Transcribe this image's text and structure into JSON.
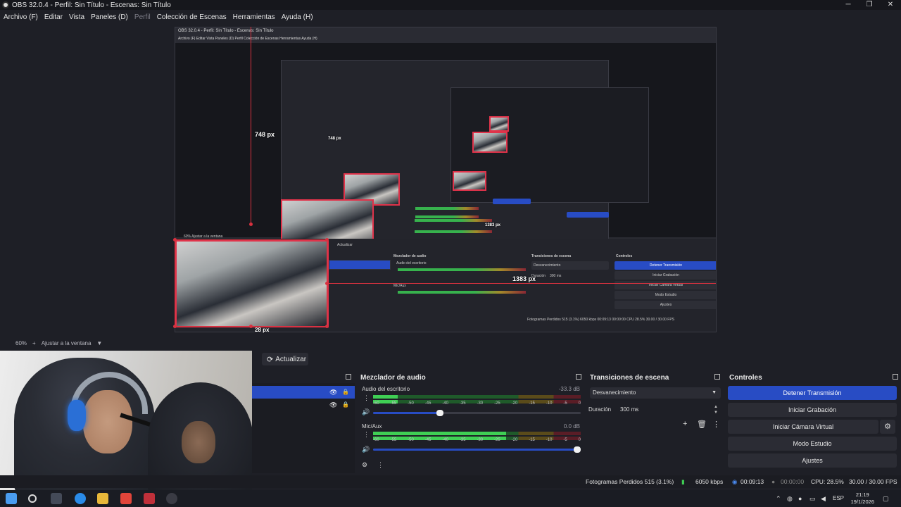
{
  "window": {
    "title": "OBS 32.0.4 - Perfil: Sin Título - Escenas: Sin Título",
    "minimize": "─",
    "maximize": "❐",
    "close": "✕"
  },
  "menu": [
    {
      "label": "Archivo (F)",
      "disabled": false
    },
    {
      "label": "Editar",
      "disabled": false
    },
    {
      "label": "Vista",
      "disabled": false
    },
    {
      "label": "Paneles (D)",
      "disabled": false
    },
    {
      "label": "Perfil",
      "disabled": true
    },
    {
      "label": "Colección de Escenas",
      "disabled": false
    },
    {
      "label": "Herramientas",
      "disabled": false
    },
    {
      "label": "Ayuda (H)",
      "disabled": false
    }
  ],
  "preview": {
    "measure_vertical": "748 px",
    "measure_horizontal": "1383 px",
    "measure_bottom": "28 px",
    "nested_vertical_2": "748 px",
    "nested_horizontal_2": "1383 px",
    "nested_title": "OBS 32.0.4 - Perfil: Sin Título - Escenas: Sin Título",
    "nested_menu": "Archivo (F)   Editar   Vista   Paneles (D)   Perfil   Colección de Escenas   Herramientas   Ayuda (H)",
    "nested_refresh": "Actualizar",
    "nested_mixer": "Mezclador de audio",
    "nested_transitions": "Transiciones de escena",
    "nested_controls": "Controles",
    "nested_stop_stream": "Detener Transmisión",
    "nested_start_rec": "Iniciar Grabación",
    "nested_virtual_cam": "Iniciar Cámara Virtual",
    "nested_studio": "Modo Estudio",
    "nested_settings": "Ajustes",
    "nested_fade": "Desvanecimiento",
    "nested_duration": "Duración",
    "nested_duration_val": "300 ms",
    "nested_desktop_audio": "Audio del escritorio",
    "nested_mic": "Mic/Aux",
    "nested_status": "Fotogramas Perdidos 515 (3.1%)   6050 kbps   00:09:13   00:00:00   CPU 28.5%   30.00 / 30.00 FPS",
    "nested_zoom": "60%     Ajustar a la ventana"
  },
  "preview_toolbar": {
    "zoom": "60%",
    "zoom_in": "+",
    "fit": "Ajustar a la ventana",
    "fit_arrow": "▼"
  },
  "sources": {
    "refresh_label": "Actualizar",
    "refresh_icon": "⟳"
  },
  "mixer": {
    "title": "Mezclador de audio",
    "channels": [
      {
        "name": "Audio del escritorio",
        "db": "-33.3 dB",
        "level": 0.12,
        "volume": 0.34
      },
      {
        "name": "Mic/Aux",
        "db": "0.0 dB",
        "level": 0.64,
        "volume": 1.0
      }
    ],
    "scale": [
      "-60",
      "-55",
      "-50",
      "-45",
      "-40",
      "-35",
      "-30",
      "-25",
      "-20",
      "-15",
      "-10",
      "-5",
      "0"
    ]
  },
  "transitions": {
    "title": "Transiciones de escena",
    "selected": "Desvanecimiento",
    "duration_label": "Duración",
    "duration_value": "300 ms"
  },
  "controls": {
    "title": "Controles",
    "stop_stream": "Detener Transmisión",
    "start_recording": "Iniciar Grabación",
    "start_virtual_cam": "Iniciar Cámara Virtual",
    "studio_mode": "Modo Estudio",
    "settings": "Ajustes"
  },
  "status": {
    "dropped": "Fotogramas Perdidos 515 (3.1%)",
    "bitrate": "6050 kbps",
    "stream_time": "00:09:13",
    "rec_time": "00:00:00",
    "cpu": "CPU: 28.5%",
    "fps": "30.00 / 30.00 FPS"
  },
  "taskbar": {
    "lang": "ESP",
    "time": "21:19",
    "date": "19/1/2026"
  },
  "colors": {
    "accent": "#284cc4",
    "guide": "#d8313f",
    "meter_green": "#3fcf54"
  }
}
